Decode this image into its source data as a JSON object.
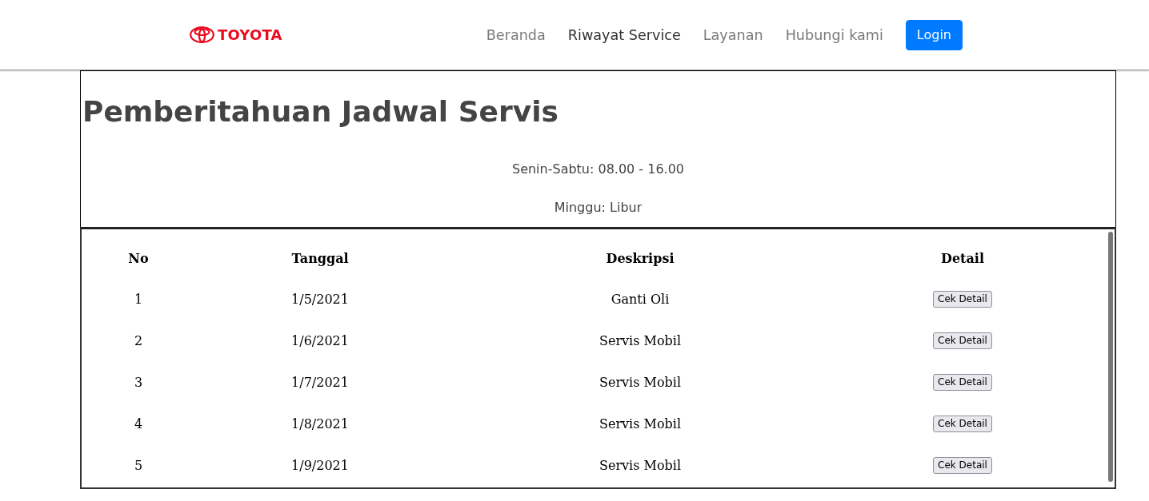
{
  "navbar": {
    "brand": "TOYOTA",
    "links": [
      {
        "label": "Beranda",
        "selected": false
      },
      {
        "label": "Riwayat Service",
        "selected": true
      },
      {
        "label": "Layanan",
        "selected": false
      },
      {
        "label": "Hubungi kami",
        "selected": false
      }
    ],
    "login_button": "Login"
  },
  "notice": {
    "title": "Pemberitahuan Jadwal Servis",
    "lines": [
      "Senin-Sabtu: 08.00 - 16.00",
      "Minggu: Libur"
    ]
  },
  "table": {
    "columns": [
      "No",
      "Tanggal",
      "Deskripsi",
      "Detail"
    ],
    "rows": [
      {
        "no": "1",
        "date": "1/5/2021",
        "description": "Ganti Oli",
        "action": "Cek Detail"
      },
      {
        "no": "2",
        "date": "1/6/2021",
        "description": "Servis Mobil",
        "action": "Cek Detail"
      },
      {
        "no": "3",
        "date": "1/7/2021",
        "description": "Servis Mobil",
        "action": "Cek Detail"
      },
      {
        "no": "4",
        "date": "1/8/2021",
        "description": "Servis Mobil",
        "action": "Cek Detail"
      },
      {
        "no": "5",
        "date": "1/9/2021",
        "description": "Servis Mobil",
        "action": "Cek Detail"
      }
    ]
  }
}
